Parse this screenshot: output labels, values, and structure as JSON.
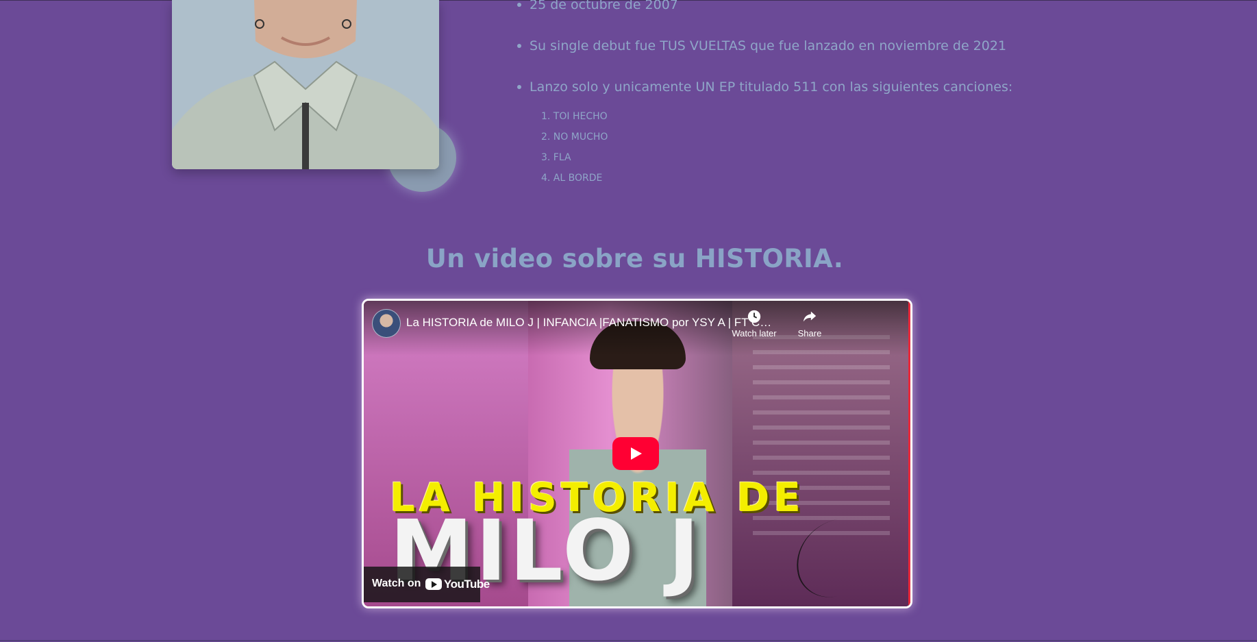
{
  "bio": {
    "items": [
      "25 de octubre de 2007",
      "Su single debut fue TUS VUELTAS que fue lanzado en noviembre de 2021",
      "Lanzo solo y unicamente UN EP titulado 511 con las siguientes canciones:"
    ],
    "songs": [
      "1. TOI HECHO",
      "2. NO MUCHO",
      "3. FLA",
      "4. AL BORDE"
    ]
  },
  "section": {
    "title": "Un video sobre su HISTORIA."
  },
  "video": {
    "title": "La HISTORIA de MILO J | INFANCIA |FANATISMO por YSY A | FT CO...",
    "watch_later": "Watch later",
    "share": "Share",
    "watch_on": "Watch on",
    "youtube": "YouTube",
    "thumb_line1": "LA HISTORIA DE",
    "thumb_line2": "MILO J",
    "play_color": "#ff0033"
  },
  "colors": {
    "background": "#6b4a97",
    "text": "#8fa6c8"
  }
}
